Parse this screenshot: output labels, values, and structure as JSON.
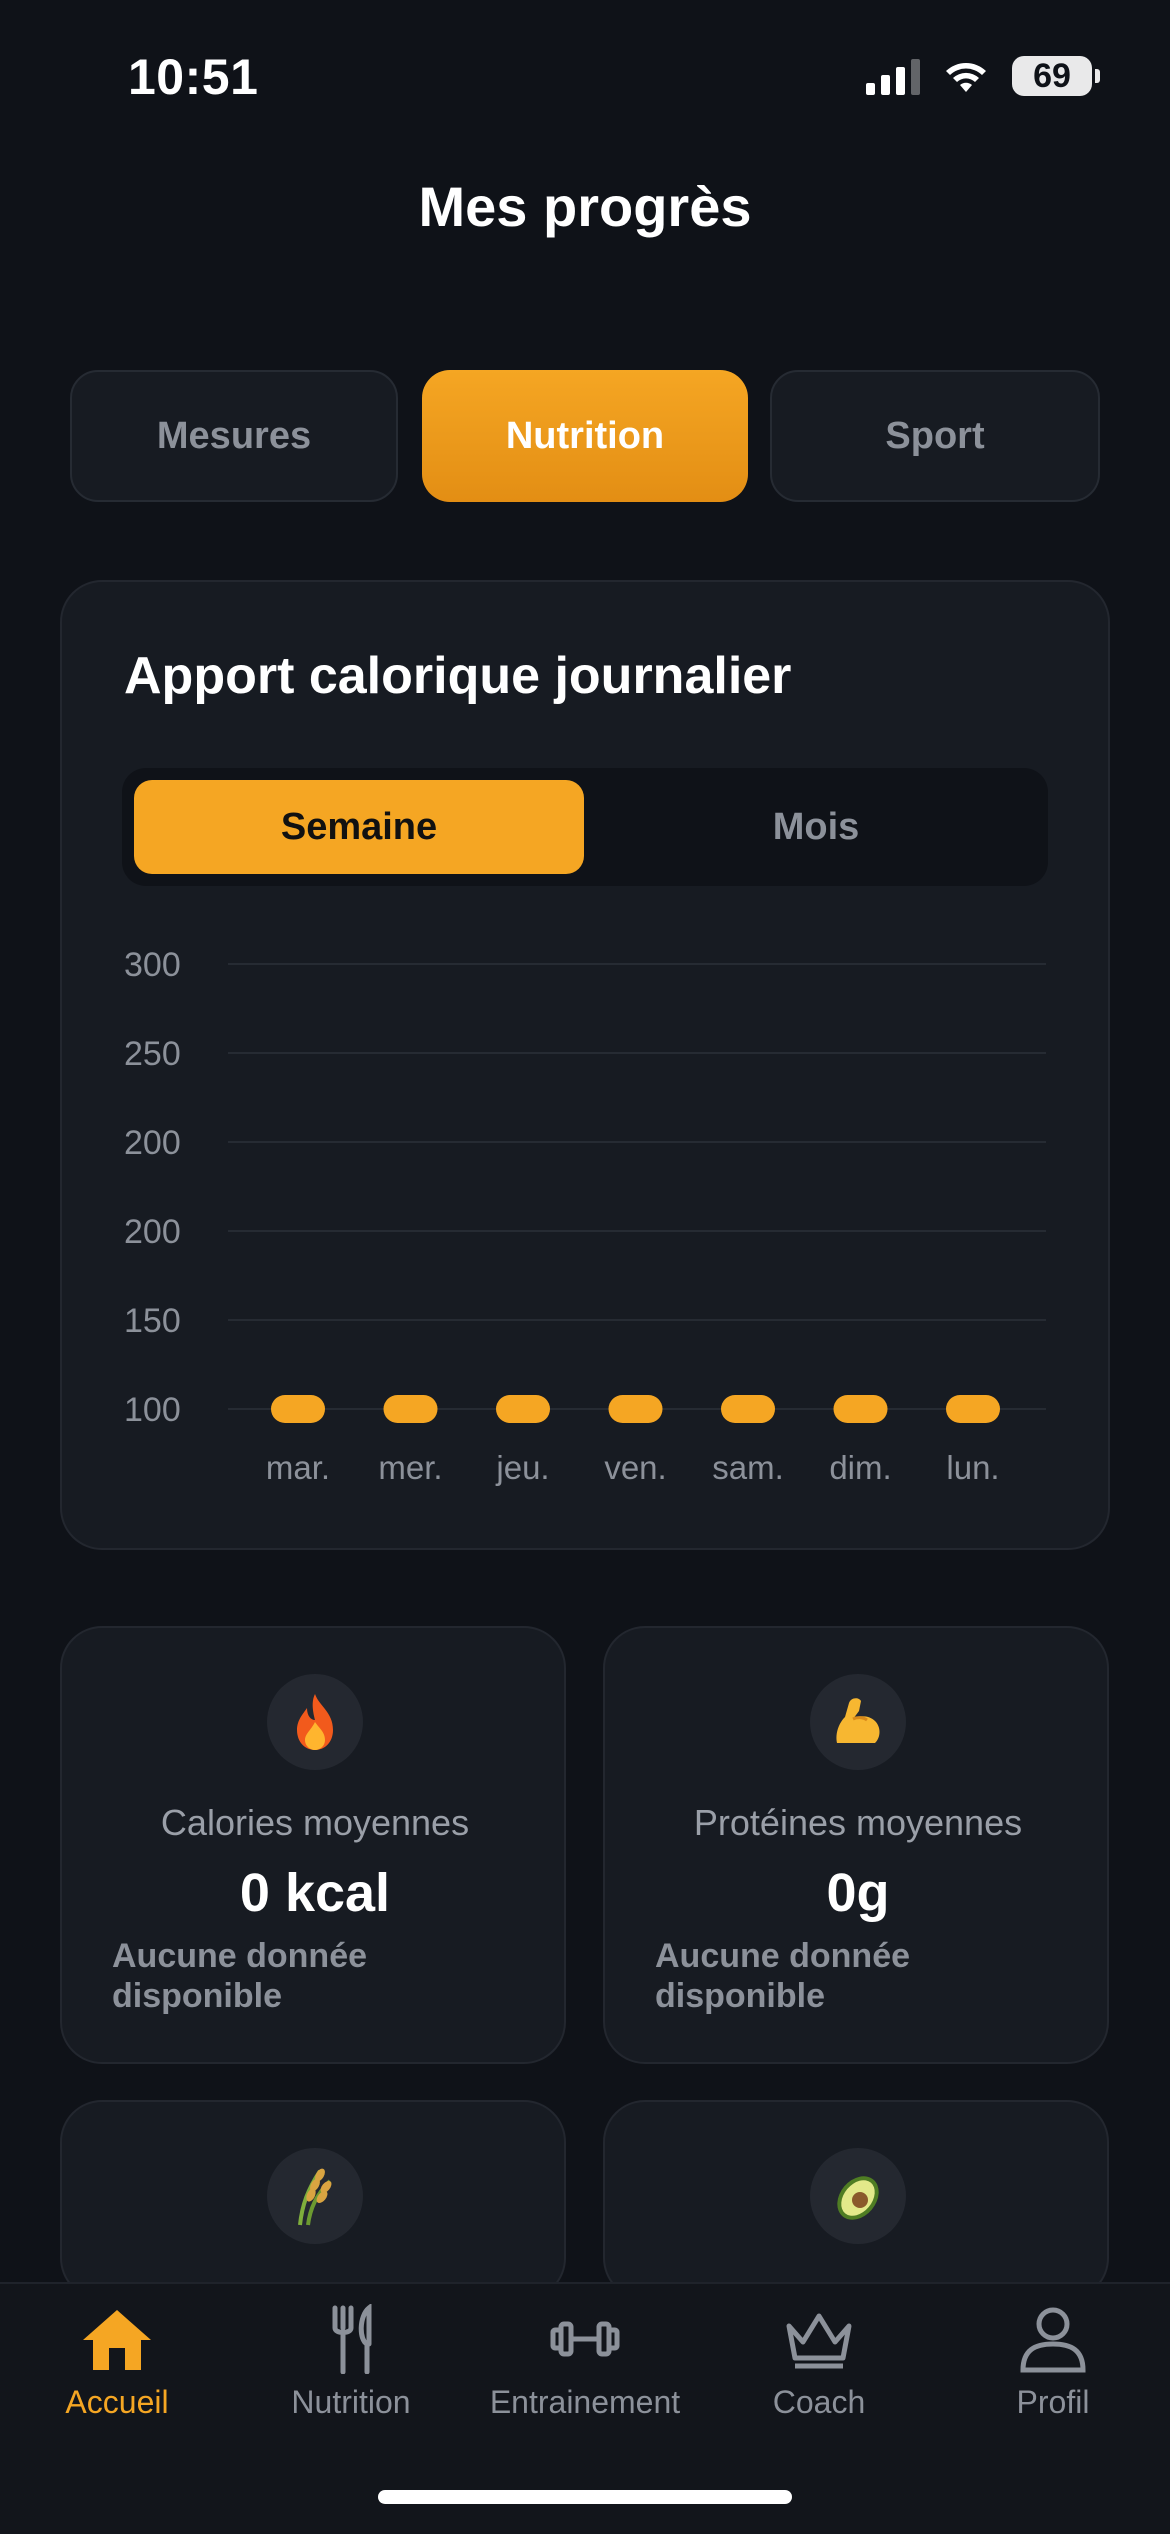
{
  "status": {
    "time": "10:51",
    "battery": "69"
  },
  "title": "Mes progrès",
  "tabs": [
    {
      "label": "Mesures",
      "active": false
    },
    {
      "label": "Nutrition",
      "active": true
    },
    {
      "label": "Sport",
      "active": false
    }
  ],
  "chart_section": {
    "title": "Apport calorique journalier",
    "segments": {
      "week": "Semaine",
      "month": "Mois",
      "selected": "week"
    }
  },
  "chart_data": {
    "type": "bar",
    "title": "",
    "categories": [
      "mar.",
      "mer.",
      "jeu.",
      "ven.",
      "sam.",
      "dim.",
      "lun."
    ],
    "values": [
      0,
      0,
      0,
      0,
      0,
      0,
      0
    ],
    "y_tick_labels": [
      "300",
      "250",
      "200",
      "200",
      "150",
      "100"
    ],
    "xlabel": "",
    "ylabel": "",
    "grid": true,
    "bar_color": "#f5a623"
  },
  "stats": [
    {
      "icon": "fire-icon",
      "label": "Calories moyennes",
      "value": "0 kcal",
      "note": "Aucune donnée disponible"
    },
    {
      "icon": "flexed-biceps-icon",
      "label": "Protéines moyennes",
      "value": "0g",
      "note": "Aucune donnée disponible"
    },
    {
      "icon": "rice-icon"
    },
    {
      "icon": "avocado-icon"
    }
  ],
  "nav": [
    {
      "label": "Accueil",
      "icon": "home-icon",
      "active": true
    },
    {
      "label": "Nutrition",
      "icon": "utensils-icon",
      "active": false
    },
    {
      "label": "Entrainement",
      "icon": "dumbbell-icon",
      "active": false
    },
    {
      "label": "Coach",
      "icon": "crown-icon",
      "active": false
    },
    {
      "label": "Profil",
      "icon": "user-icon",
      "active": false
    }
  ],
  "colors": {
    "accent": "#f5a623",
    "background": "#0f1218",
    "card": "#171b22"
  }
}
